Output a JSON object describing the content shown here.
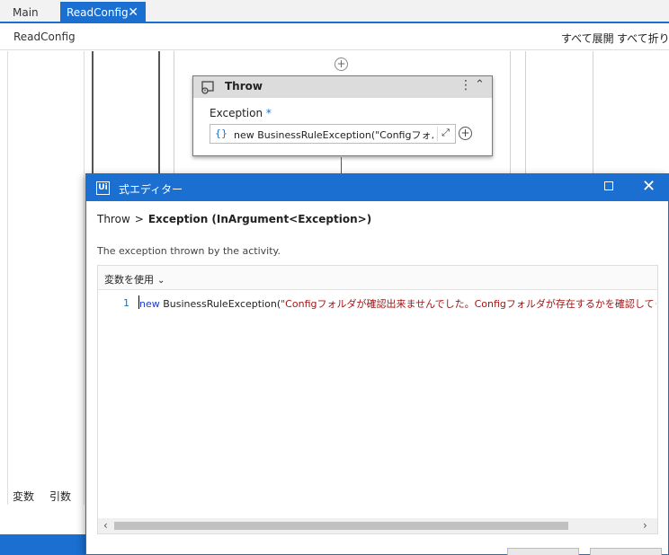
{
  "tabs": [
    {
      "label": "Main"
    },
    {
      "label": "ReadConfig"
    }
  ],
  "header": {
    "breadcrumb": "ReadConfig",
    "expand_all": "すべて展開",
    "collapse_all": "すべて折りた"
  },
  "bottom_tabs": [
    {
      "label": "変数"
    },
    {
      "label": "引数"
    }
  ],
  "activity": {
    "title": "Throw",
    "property_label": "Exception",
    "required_mark": "*",
    "braces": "{}",
    "value": "new BusinessRuleException(\"Configフォルダ"
  },
  "dialog": {
    "logo": "Ui",
    "title": "式エディター",
    "crumb_parent": "Throw",
    "crumb_sep": ">",
    "crumb_current": "Exception (InArgument<Exception>)",
    "description": "The exception thrown by the activity.",
    "use_variables": "変数を使用",
    "line_number": "1",
    "code_keyword": "new",
    "code_class": " BusinessRuleException(",
    "code_string": "\"Configフォルダが確認出来ませんでした。Configフォルダが存在するかを確認してください。\""
  },
  "colors": {
    "accent": "#1a6fd1",
    "string": "#a31515",
    "keyword": "#1a3ccf"
  }
}
